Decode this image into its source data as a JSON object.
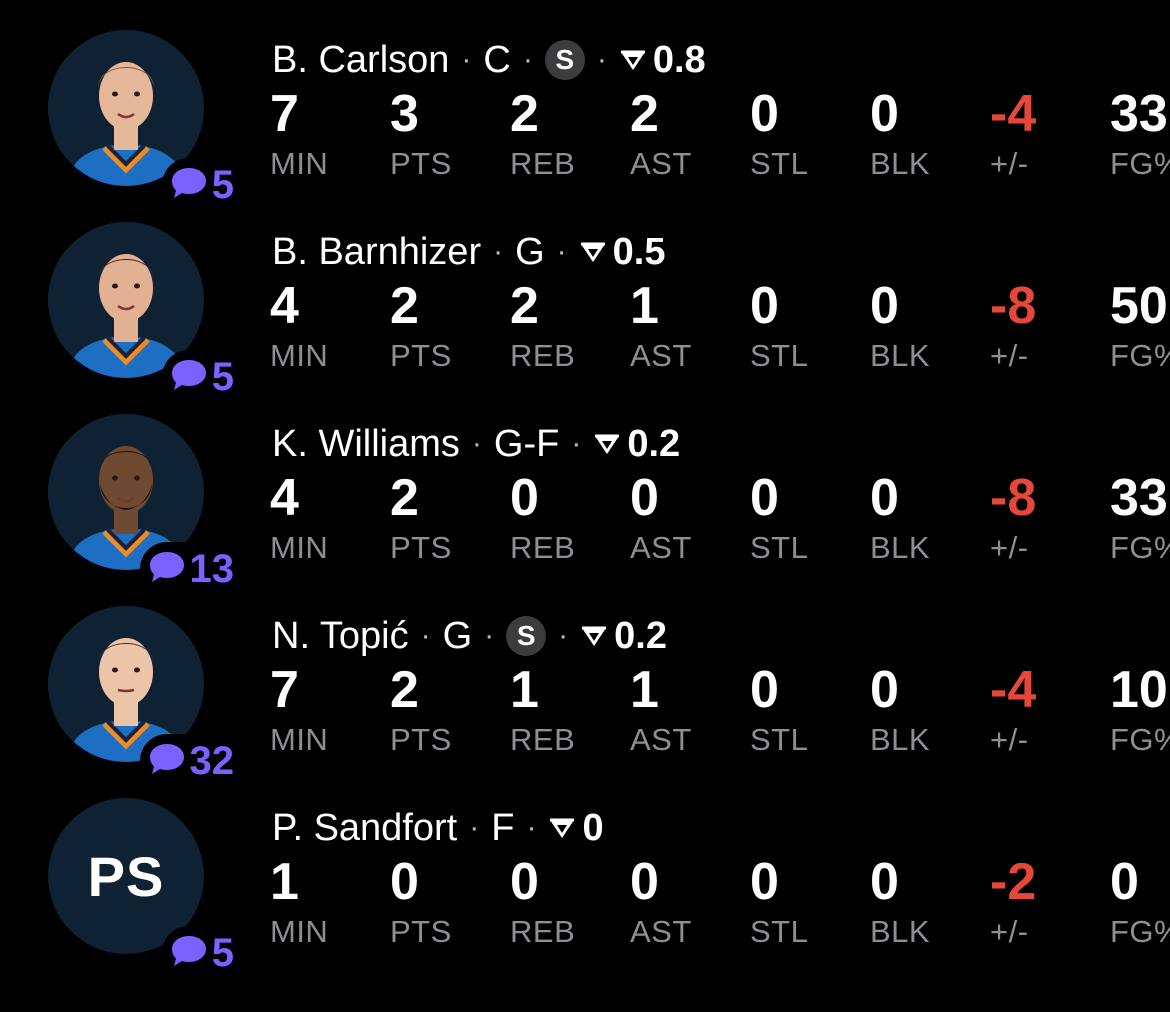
{
  "stat_labels": [
    "MIN",
    "PTS",
    "REB",
    "AST",
    "STL",
    "BLK",
    "+/-",
    "FG%"
  ],
  "colors": {
    "background": "#000000",
    "accent_purple": "#7b61ff",
    "negative_red": "#e5483a",
    "label_gray": "#8e8e93"
  },
  "players": [
    {
      "name": "B. Carlson",
      "position": "C",
      "starter_badge": "S",
      "rating": "0.8",
      "comments": "5",
      "avatar": "player-photo",
      "stats": [
        "7",
        "3",
        "2",
        "2",
        "0",
        "0",
        "-4",
        "33"
      ]
    },
    {
      "name": "B. Barnhizer",
      "position": "G",
      "starter_badge": null,
      "rating": "0.5",
      "comments": "5",
      "avatar": "player-photo",
      "stats": [
        "4",
        "2",
        "2",
        "1",
        "0",
        "0",
        "-8",
        "50"
      ]
    },
    {
      "name": "K. Williams",
      "position": "G-F",
      "starter_badge": null,
      "rating": "0.2",
      "comments": "13",
      "avatar": "player-photo",
      "stats": [
        "4",
        "2",
        "0",
        "0",
        "0",
        "0",
        "-8",
        "33"
      ]
    },
    {
      "name": "N. Topić",
      "position": "G",
      "starter_badge": "S",
      "rating": "0.2",
      "comments": "32",
      "avatar": "player-photo",
      "stats": [
        "7",
        "2",
        "1",
        "1",
        "0",
        "0",
        "-4",
        "10"
      ]
    },
    {
      "name": "P. Sandfort",
      "position": "F",
      "starter_badge": null,
      "rating": "0",
      "comments": "5",
      "avatar_initials": "PS",
      "stats": [
        "1",
        "0",
        "0",
        "0",
        "0",
        "0",
        "-2",
        "0"
      ]
    }
  ]
}
